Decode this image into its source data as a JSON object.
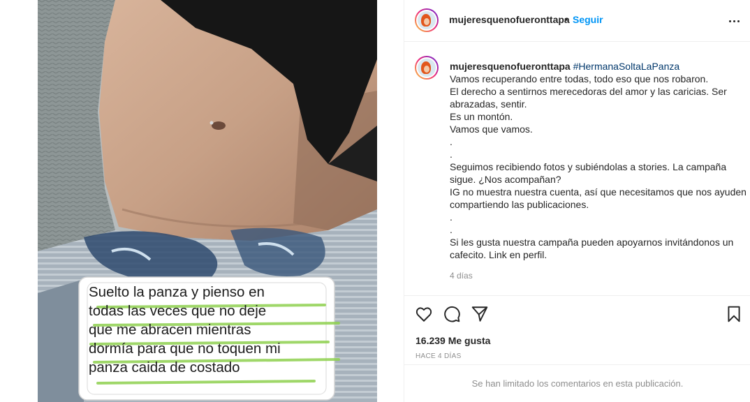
{
  "post": {
    "username": "mujeresquenofueronttapa",
    "follow_label": "Seguir",
    "dot": "•",
    "image_text_lines": [
      "Suelto la panza y pienso en",
      "todas las veces que no deje",
      "que me abracen mientras",
      "dormía para que no toquen mi",
      "panza caida de costado"
    ]
  },
  "caption": {
    "username": "mujeresquenofueronttapa",
    "hashtag": "#HermanaSoltaLaPanza",
    "lines": [
      "Vamos recuperando entre todas, todo eso que nos robaron.",
      "El derecho a sentirnos merecedoras del amor y las caricias. Ser",
      "abrazadas, sentir.",
      "Es un montón.",
      "Vamos que vamos.",
      ".",
      ".",
      "Seguimos recibiendo fotos y subiéndolas a stories. La campaña",
      "sigue. ¿Nos acompañan?",
      "IG no muestra nuestra cuenta, así que necesitamos que nos ayuden",
      "compartiendo las publicaciones.",
      ".",
      ".",
      "Si les gusta nuestra campaña pueden apoyarnos invitándonos un",
      "cafecito. Link en perfil."
    ],
    "time": "4 días"
  },
  "actions": {
    "like_icon": "heart-icon",
    "comment_icon": "comment-icon",
    "share_icon": "paper-plane-icon",
    "save_icon": "bookmark-icon"
  },
  "likes_text": "16.239 Me gusta",
  "date_text": "HACE 4 DÍAS",
  "comments_limited_text": "Se han limitado los comentarios en esta publicación.",
  "colors": {
    "link_blue": "#0095f6",
    "hashtag_blue": "#00376b",
    "muted_gray": "#8e8e8e",
    "highlight_green": "#8fd14f"
  }
}
